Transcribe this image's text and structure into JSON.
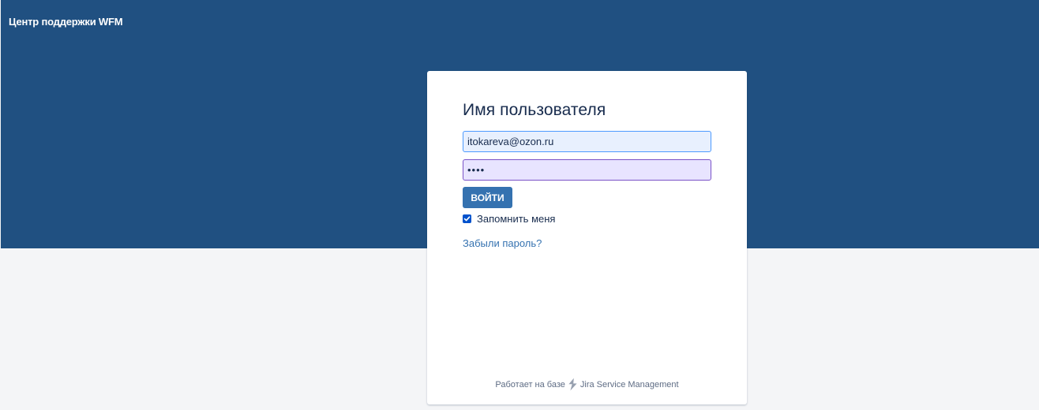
{
  "header": {
    "portal_title": "Центр поддержки WFM"
  },
  "login": {
    "title": "Имя пользователя",
    "username_value": "itokareva@ozon.ru",
    "password_value": "••••",
    "submit_label": "ВОЙТИ",
    "remember_label": "Запомнить меня",
    "remember_checked": true,
    "forgot_label": "Забыли пароль?"
  },
  "footer": {
    "prefix": "Работает на базе",
    "product": "Jira Service Management",
    "icon": "jira-service-management-icon"
  },
  "colors": {
    "header_bg": "#205081",
    "page_bg": "#f4f5f7",
    "button_bg": "#3572b0",
    "link": "#3572b0",
    "checkbox": "#0052cc"
  }
}
